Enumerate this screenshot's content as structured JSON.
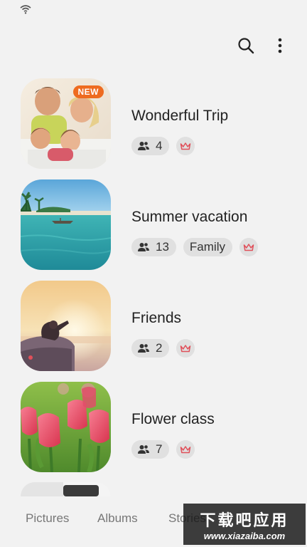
{
  "status_bar": {
    "wifi_icon": "wifi-icon"
  },
  "app_bar": {
    "search_icon": "search-icon",
    "more_icon": "more-vertical-icon"
  },
  "groups": [
    {
      "title": "Wonderful Trip",
      "members": "4",
      "badge": "NEW",
      "tags": []
    },
    {
      "title": "Summer vacation",
      "members": "13",
      "badge": "",
      "tags": [
        "Family"
      ]
    },
    {
      "title": "Friends",
      "members": "2",
      "badge": "",
      "tags": []
    },
    {
      "title": "Flower class",
      "members": "7",
      "badge": "",
      "tags": []
    }
  ],
  "bottom_nav": {
    "tabs": [
      "Pictures",
      "Albums",
      "Stories"
    ]
  },
  "watermark": {
    "line1": "下载吧应用",
    "line2": "www.xiazaiba.com"
  },
  "colors": {
    "badge": "#ee6b1f",
    "crown": "#e0505a",
    "chip_bg": "#e0e0e0"
  }
}
